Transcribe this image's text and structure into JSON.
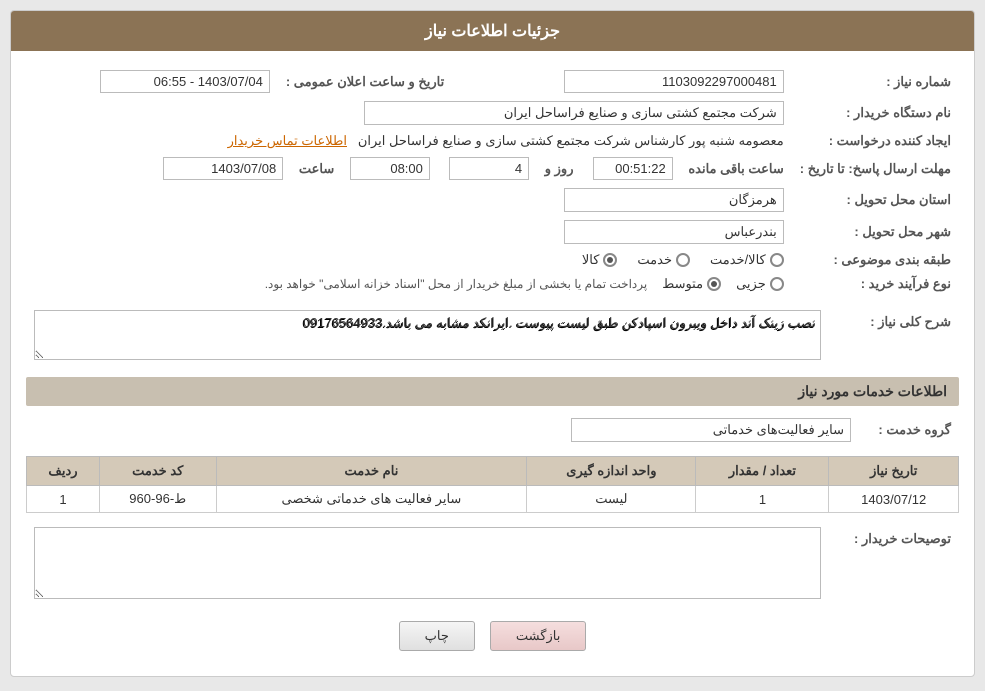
{
  "header": {
    "title": "جزئیات اطلاعات نیاز"
  },
  "fields": {
    "shomara_niaz_label": "شماره نیاز :",
    "shomara_niaz_value": "1103092297000481",
    "nam_dastgah_label": "نام دستگاه خریدار :",
    "nam_dastgah_value": "شرکت مجتمع کشتی سازی و صنایع فراساحل ایران",
    "ijad_label": "ایجاد کننده درخواست :",
    "ijad_value": "معصومه شنبه پور کارشناس شرکت مجتمع کشتی سازی و صنایع فراساحل ایران",
    "ijad_link": "اطلاعات تماس خریدار",
    "mohlat_label": "مهلت ارسال پاسخ: تا تاریخ :",
    "mohlat_date": "1403/07/08",
    "mohlat_saat_label": "ساعت",
    "mohlat_saat": "08:00",
    "mohlat_rooz_label": "روز و",
    "mohlat_rooz": "4",
    "mohlat_baqi": "00:51:22",
    "mohlat_baqi_label": "ساعت باقی مانده",
    "tarikh_label": "تاریخ و ساعت اعلان عمومی :",
    "tarikh_value": "1403/07/04 - 06:55",
    "ostan_label": "استان محل تحویل :",
    "ostan_value": "هرمزگان",
    "shahr_label": "شهر محل تحویل :",
    "shahr_value": "بندرعباس",
    "tabaqe_label": "طبقه بندی موضوعی :",
    "tabaqe_kala": "کالا",
    "tabaqe_khadamat": "خدمت",
    "tabaqe_kala_khadamat": "کالا/خدمت",
    "nooe_label": "نوع فرآیند خرید :",
    "nooe_jazyi": "جزیی",
    "nooe_motovaset": "متوسط",
    "nooe_note": "پرداخت تمام یا بخشی از مبلغ خریدار از محل \"اسناد خزانه اسلامی\" خواهد بود.",
    "sharh_label": "شرح کلی نیاز :",
    "sharh_value": "نصب زینک آند داخل ویبرون اسپادکن طبق لیست پیوست .ایرانکد مشابه می باشد.09176564933",
    "khadamat_header": "اطلاعات خدمات مورد نیاز",
    "grohe_label": "گروه خدمت :",
    "grohe_value": "سایر فعالیت‌های خدماتی",
    "table_headers": {
      "radif": "ردیف",
      "code": "کد خدمت",
      "name": "نام خدمت",
      "unit": "واحد اندازه گیری",
      "count": "تعداد / مقدار",
      "date": "تاریخ نیاز"
    },
    "table_rows": [
      {
        "radif": "1",
        "code": "ط-96-960",
        "name": "سایر فعالیت های خدماتی شخصی",
        "unit": "لیست",
        "count": "1",
        "date": "1403/07/12"
      }
    ],
    "tosif_label": "توصیحات خریدار :",
    "tosif_value": ""
  },
  "buttons": {
    "print": "چاپ",
    "back": "بازگشت"
  }
}
